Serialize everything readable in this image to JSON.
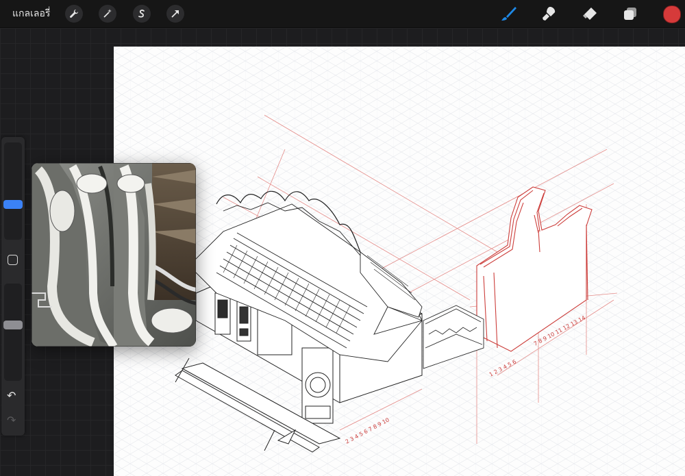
{
  "toolbar": {
    "gallery_label": "แกลเลอรี่",
    "left_tools": [
      {
        "name": "wrench-icon",
        "glyph": "🔧"
      },
      {
        "name": "magic-wand-icon",
        "glyph": "✦"
      },
      {
        "name": "selection-icon",
        "glyph": "S"
      },
      {
        "name": "transform-arrow-icon",
        "glyph": "➚"
      }
    ],
    "right_tools": [
      "brush-icon",
      "smudge-icon",
      "eraser-icon",
      "layers-icon"
    ],
    "current_color": "#d63a3a",
    "active_tool_color": "#1e88e5"
  },
  "sidebar": {
    "brush_size_level": 0.35,
    "opacity_level": 0.58,
    "undo_glyph": "↶",
    "redo_glyph": "↷"
  },
  "canvas": {
    "description_colors": {
      "line": "#2a2a2a",
      "construction": "#d9534f"
    }
  }
}
